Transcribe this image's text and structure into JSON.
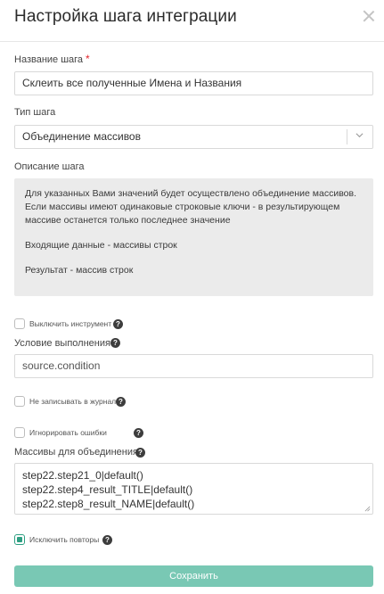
{
  "dialog": {
    "title": "Настройка шага интеграции"
  },
  "step_name": {
    "label": "Название шага",
    "required_mark": "*",
    "value": "Склеить все полученные Имена и Названия"
  },
  "step_type": {
    "label": "Тип шага",
    "selected": "Объединение массивов"
  },
  "description": {
    "label": "Описание шага",
    "line1": "Для указанных Вами значений будет осуществлено объединение массивов.",
    "line2": "Если массивы имеют одинаковые строковые ключи - в результирующем",
    "line3": "массиве останется только последнее значение",
    "input_text": "Входящие данные - массивы строк",
    "result_text": "Результат - массив строк"
  },
  "disable_tool": {
    "label": "Выключить инструмент",
    "checked": false
  },
  "condition": {
    "label": "Условие выполнения",
    "value": "source.condition"
  },
  "no_log": {
    "label": "Не записывать в журнал",
    "checked": false
  },
  "ignore_errors": {
    "label": "Игнорировать ошибки",
    "checked": false
  },
  "arrays": {
    "label": "Массивы для объединения",
    "lines": [
      "step22.step21_0|default()",
      "step22.step4_result_TITLE|default()",
      "step22.step8_result_NAME|default()"
    ]
  },
  "exclude_duplicates": {
    "label": "Исключить повторы",
    "checked": true
  },
  "help_glyph": "?",
  "actions": {
    "save_label": "Сохранить"
  },
  "colors": {
    "accent": "#2e9f82",
    "save_button": "#79c8b4",
    "required": "#e2252b",
    "description_bg": "#ebebeb"
  }
}
